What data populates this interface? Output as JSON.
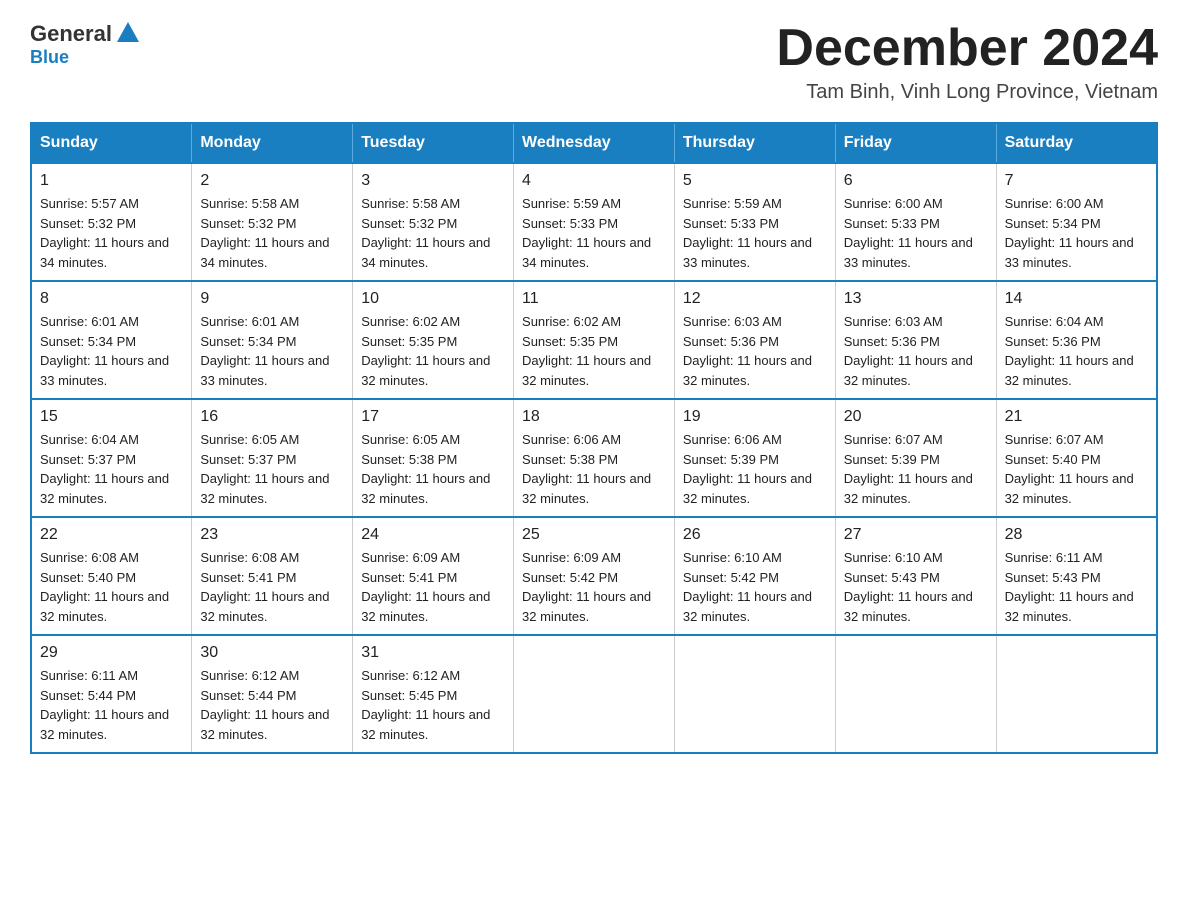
{
  "header": {
    "logo": {
      "general": "General",
      "blue": "Blue",
      "triangle": "▲"
    },
    "month_title": "December 2024",
    "location": "Tam Binh, Vinh Long Province, Vietnam"
  },
  "days_of_week": [
    "Sunday",
    "Monday",
    "Tuesday",
    "Wednesday",
    "Thursday",
    "Friday",
    "Saturday"
  ],
  "weeks": [
    [
      {
        "day": "1",
        "info": "Sunrise: 5:57 AM\nSunset: 5:32 PM\nDaylight: 11 hours and 34 minutes."
      },
      {
        "day": "2",
        "info": "Sunrise: 5:58 AM\nSunset: 5:32 PM\nDaylight: 11 hours and 34 minutes."
      },
      {
        "day": "3",
        "info": "Sunrise: 5:58 AM\nSunset: 5:32 PM\nDaylight: 11 hours and 34 minutes."
      },
      {
        "day": "4",
        "info": "Sunrise: 5:59 AM\nSunset: 5:33 PM\nDaylight: 11 hours and 34 minutes."
      },
      {
        "day": "5",
        "info": "Sunrise: 5:59 AM\nSunset: 5:33 PM\nDaylight: 11 hours and 33 minutes."
      },
      {
        "day": "6",
        "info": "Sunrise: 6:00 AM\nSunset: 5:33 PM\nDaylight: 11 hours and 33 minutes."
      },
      {
        "day": "7",
        "info": "Sunrise: 6:00 AM\nSunset: 5:34 PM\nDaylight: 11 hours and 33 minutes."
      }
    ],
    [
      {
        "day": "8",
        "info": "Sunrise: 6:01 AM\nSunset: 5:34 PM\nDaylight: 11 hours and 33 minutes."
      },
      {
        "day": "9",
        "info": "Sunrise: 6:01 AM\nSunset: 5:34 PM\nDaylight: 11 hours and 33 minutes."
      },
      {
        "day": "10",
        "info": "Sunrise: 6:02 AM\nSunset: 5:35 PM\nDaylight: 11 hours and 32 minutes."
      },
      {
        "day": "11",
        "info": "Sunrise: 6:02 AM\nSunset: 5:35 PM\nDaylight: 11 hours and 32 minutes."
      },
      {
        "day": "12",
        "info": "Sunrise: 6:03 AM\nSunset: 5:36 PM\nDaylight: 11 hours and 32 minutes."
      },
      {
        "day": "13",
        "info": "Sunrise: 6:03 AM\nSunset: 5:36 PM\nDaylight: 11 hours and 32 minutes."
      },
      {
        "day": "14",
        "info": "Sunrise: 6:04 AM\nSunset: 5:36 PM\nDaylight: 11 hours and 32 minutes."
      }
    ],
    [
      {
        "day": "15",
        "info": "Sunrise: 6:04 AM\nSunset: 5:37 PM\nDaylight: 11 hours and 32 minutes."
      },
      {
        "day": "16",
        "info": "Sunrise: 6:05 AM\nSunset: 5:37 PM\nDaylight: 11 hours and 32 minutes."
      },
      {
        "day": "17",
        "info": "Sunrise: 6:05 AM\nSunset: 5:38 PM\nDaylight: 11 hours and 32 minutes."
      },
      {
        "day": "18",
        "info": "Sunrise: 6:06 AM\nSunset: 5:38 PM\nDaylight: 11 hours and 32 minutes."
      },
      {
        "day": "19",
        "info": "Sunrise: 6:06 AM\nSunset: 5:39 PM\nDaylight: 11 hours and 32 minutes."
      },
      {
        "day": "20",
        "info": "Sunrise: 6:07 AM\nSunset: 5:39 PM\nDaylight: 11 hours and 32 minutes."
      },
      {
        "day": "21",
        "info": "Sunrise: 6:07 AM\nSunset: 5:40 PM\nDaylight: 11 hours and 32 minutes."
      }
    ],
    [
      {
        "day": "22",
        "info": "Sunrise: 6:08 AM\nSunset: 5:40 PM\nDaylight: 11 hours and 32 minutes."
      },
      {
        "day": "23",
        "info": "Sunrise: 6:08 AM\nSunset: 5:41 PM\nDaylight: 11 hours and 32 minutes."
      },
      {
        "day": "24",
        "info": "Sunrise: 6:09 AM\nSunset: 5:41 PM\nDaylight: 11 hours and 32 minutes."
      },
      {
        "day": "25",
        "info": "Sunrise: 6:09 AM\nSunset: 5:42 PM\nDaylight: 11 hours and 32 minutes."
      },
      {
        "day": "26",
        "info": "Sunrise: 6:10 AM\nSunset: 5:42 PM\nDaylight: 11 hours and 32 minutes."
      },
      {
        "day": "27",
        "info": "Sunrise: 6:10 AM\nSunset: 5:43 PM\nDaylight: 11 hours and 32 minutes."
      },
      {
        "day": "28",
        "info": "Sunrise: 6:11 AM\nSunset: 5:43 PM\nDaylight: 11 hours and 32 minutes."
      }
    ],
    [
      {
        "day": "29",
        "info": "Sunrise: 6:11 AM\nSunset: 5:44 PM\nDaylight: 11 hours and 32 minutes."
      },
      {
        "day": "30",
        "info": "Sunrise: 6:12 AM\nSunset: 5:44 PM\nDaylight: 11 hours and 32 minutes."
      },
      {
        "day": "31",
        "info": "Sunrise: 6:12 AM\nSunset: 5:45 PM\nDaylight: 11 hours and 32 minutes."
      },
      {
        "day": "",
        "info": ""
      },
      {
        "day": "",
        "info": ""
      },
      {
        "day": "",
        "info": ""
      },
      {
        "day": "",
        "info": ""
      }
    ]
  ]
}
